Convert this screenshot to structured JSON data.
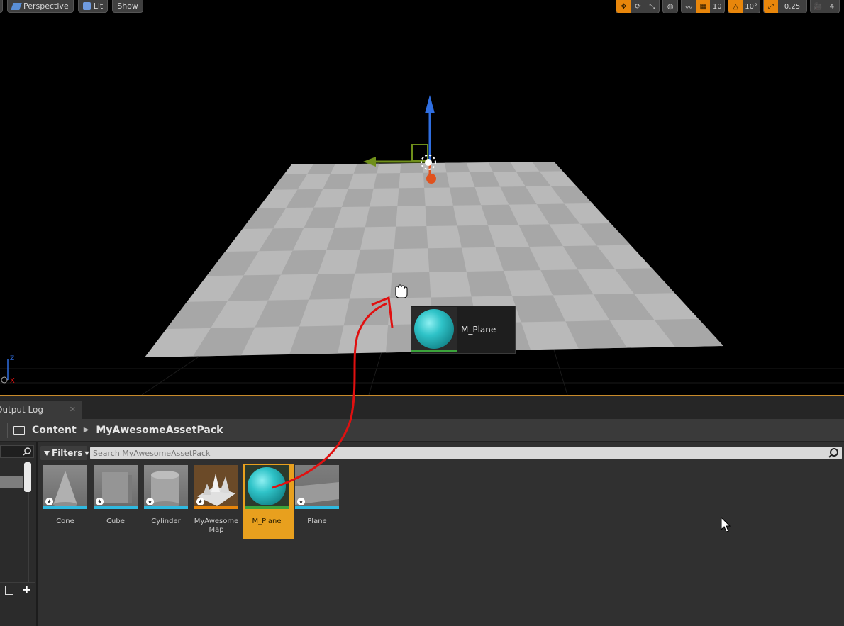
{
  "viewport": {
    "toolbar_left": [
      {
        "label": "Perspective",
        "icon": "perspective-icon"
      },
      {
        "label": "Lit",
        "icon": "lit-cube-icon"
      },
      {
        "label": "Show",
        "icon": ""
      }
    ],
    "toolbar_right": {
      "grid_snap_value": "10",
      "rotation_snap_value": "10°",
      "scale_snap_value": "0.25",
      "camera_speed_value": "4"
    },
    "drag_preview": {
      "label": "M_Plane",
      "icon": "material-sphere-icon"
    },
    "axis_labels": {
      "z": "Z",
      "x": "X"
    },
    "colors": {
      "accent": "#e8860b",
      "arrow": "#e01010",
      "gizmo_up": "#2f6ee0",
      "gizmo_side": "#6f8f1a",
      "gizmo_forward": "#e0521e"
    }
  },
  "panel": {
    "tab": {
      "label": "Output Log"
    },
    "breadcrumb": [
      "Content",
      "MyAwesomeAssetPack"
    ],
    "filters_label": "Filters",
    "search_placeholder": "Search MyAwesomeAssetPack",
    "assets": [
      {
        "label": "Cone",
        "type": "static-mesh",
        "selected": false
      },
      {
        "label": "Cube",
        "type": "static-mesh",
        "selected": false
      },
      {
        "label": "Cylinder",
        "type": "static-mesh",
        "selected": false
      },
      {
        "label": "MyAwesome Map",
        "type": "map",
        "selected": false
      },
      {
        "label": "M_Plane",
        "type": "material",
        "selected": true
      },
      {
        "label": "Plane",
        "type": "static-mesh",
        "selected": false
      }
    ]
  }
}
